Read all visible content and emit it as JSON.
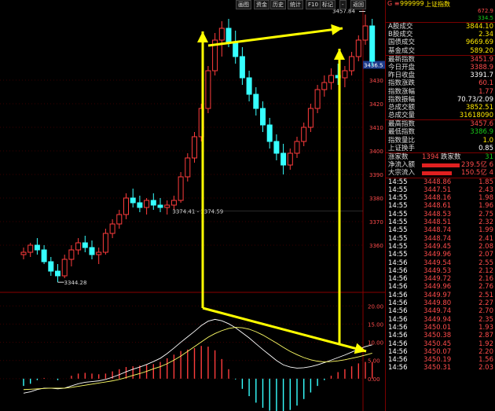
{
  "toolbar": {
    "buttons": [
      "画图",
      "资金",
      "历史",
      "统计",
      "F10",
      "标记",
      "-",
      "返回"
    ]
  },
  "price_axis": {
    "labels": [
      "3430",
      "3420",
      "3410",
      "3400",
      "3390",
      "3380",
      "3370",
      "3360"
    ],
    "current_price_tag": "3436.5"
  },
  "annotations": {
    "high_label": "3457.84",
    "mid_label": "3374.41 - 3374.59",
    "low_label": "3344.28"
  },
  "macd_axis": {
    "labels": [
      "20.00",
      "15.00",
      "10.00",
      "5.00",
      "0.00"
    ]
  },
  "chart_data": {
    "type": "candlestick",
    "price_ylim": [
      3344,
      3460
    ],
    "candles": [
      [
        3356,
        3359,
        3354,
        3357
      ],
      [
        3357,
        3361,
        3355,
        3360
      ],
      [
        3360,
        3363,
        3356,
        3358
      ],
      [
        3358,
        3360,
        3352,
        3353
      ],
      [
        3353,
        3355,
        3347,
        3349
      ],
      [
        3349,
        3352,
        3344.28,
        3347
      ],
      [
        3347,
        3356,
        3346,
        3354
      ],
      [
        3354,
        3360,
        3351,
        3358
      ],
      [
        3358,
        3363,
        3356,
        3361
      ],
      [
        3361,
        3364,
        3357,
        3359
      ],
      [
        3359,
        3362,
        3354,
        3356
      ],
      [
        3356,
        3359,
        3352,
        3357
      ],
      [
        3357,
        3367,
        3356,
        3365
      ],
      [
        3365,
        3371,
        3363,
        3369
      ],
      [
        3369,
        3375,
        3367,
        3373
      ],
      [
        3373,
        3382,
        3371,
        3380
      ],
      [
        3380,
        3384,
        3376,
        3378
      ],
      [
        3378,
        3381,
        3374,
        3376
      ],
      [
        3376,
        3380,
        3373,
        3379
      ],
      [
        3379,
        3382,
        3375,
        3377
      ],
      [
        3377,
        3380,
        3374,
        3376
      ],
      [
        3376,
        3379,
        3373,
        3377
      ],
      [
        3377,
        3381,
        3375,
        3379
      ],
      [
        3379,
        3391,
        3378,
        3389
      ],
      [
        3389,
        3399,
        3387,
        3397
      ],
      [
        3397,
        3408,
        3395,
        3406
      ],
      [
        3406,
        3420,
        3404,
        3418
      ],
      [
        3418,
        3436,
        3416,
        3434
      ],
      [
        3434,
        3450,
        3432,
        3447
      ],
      [
        3447,
        3455,
        3440,
        3452
      ],
      [
        3452,
        3456,
        3444,
        3446
      ],
      [
        3446,
        3451,
        3437,
        3440
      ],
      [
        3440,
        3444,
        3428,
        3431
      ],
      [
        3431,
        3434,
        3421,
        3424
      ],
      [
        3424,
        3427,
        3415,
        3418
      ],
      [
        3418,
        3421,
        3408,
        3411
      ],
      [
        3411,
        3414,
        3401,
        3404
      ],
      [
        3404,
        3407,
        3396,
        3399
      ],
      [
        3399,
        3403,
        3390,
        3394
      ],
      [
        3394,
        3401,
        3392,
        3399
      ],
      [
        3399,
        3406,
        3397,
        3404
      ],
      [
        3404,
        3412,
        3402,
        3410
      ],
      [
        3410,
        3420,
        3408,
        3418
      ],
      [
        3418,
        3428,
        3416,
        3426
      ],
      [
        3426,
        3432,
        3423,
        3429
      ],
      [
        3429,
        3435,
        3426,
        3432
      ],
      [
        3432,
        3437,
        3428,
        3431
      ],
      [
        3431,
        3436,
        3427,
        3434
      ],
      [
        3434,
        3442,
        3432,
        3440
      ],
      [
        3440,
        3449,
        3438,
        3447
      ],
      [
        3447,
        3457.84,
        3445,
        3453
      ],
      [
        3453,
        3456,
        3436,
        3438
      ]
    ],
    "macd_ylim": [
      -5,
      22
    ],
    "dif": [
      -4,
      -3.6,
      -3,
      -2.6,
      -2.6,
      -2.8,
      -2.6,
      -2,
      -1.4,
      -1,
      -0.8,
      -0.6,
      -0.2,
      0.4,
      1.1,
      1.9,
      2.6,
      3.2,
      3.9,
      4.7,
      5.6,
      6.9,
      8.4,
      10,
      11.5,
      13,
      14.6,
      15.8,
      16.3,
      15.9,
      15.1,
      14,
      12.6,
      11.2,
      9.6,
      8,
      6.5,
      5,
      3.8,
      3.2,
      2.9,
      3,
      3.3,
      3.8,
      4.4,
      5.1,
      5.8,
      6.5,
      7.3,
      8.1,
      8.8,
      9.3
    ],
    "dea": [
      -3,
      -2.9,
      -2.8,
      -2.7,
      -2.6,
      -2.6,
      -2.6,
      -2.4,
      -2.1,
      -1.8,
      -1.5,
      -1.2,
      -0.9,
      -0.6,
      -0.2,
      0.3,
      0.9,
      1.4,
      2,
      2.7,
      3.3,
      4.1,
      5.1,
      6.2,
      7.5,
      8.8,
      10.1,
      11.4,
      12.4,
      13.2,
      13.8,
      14.1,
      14,
      13.6,
      12.9,
      12,
      10.9,
      9.8,
      8.6,
      7.5,
      6.6,
      5.8,
      5.2,
      4.8,
      4.6,
      4.7,
      4.9,
      5.2,
      5.6,
      6,
      6.5,
      7
    ]
  },
  "quote": {
    "header": {
      "code_prefix": "G ≡",
      "code": "999999",
      "name": "上证指数",
      "val1": "672.9",
      "val2": "334.5"
    },
    "rows": [
      {
        "label": "A股成交",
        "value": "3844.10"
      },
      {
        "label": "B股成交",
        "value": "2.34"
      },
      {
        "label": "国债成交",
        "value": "9669.69"
      },
      {
        "label": "基金成交",
        "value": "589.20"
      },
      {
        "label": "最新指数",
        "value": "3451.9"
      },
      {
        "label": "今日开盘",
        "value": "3388.9"
      },
      {
        "label": "昨日收盘",
        "value": "3391.7"
      },
      {
        "label": "指数涨跌",
        "value": "60.1"
      },
      {
        "label": "指数涨幅",
        "value": "1.77"
      },
      {
        "label": "指数振幅",
        "value": "70.73/2.09"
      },
      {
        "label": "总成交额",
        "value": "3852.51"
      },
      {
        "label": "总成交量",
        "value": "31618090"
      },
      {
        "label": "最高指数",
        "value": "3457.6"
      },
      {
        "label": "最低指数",
        "value": "3386.9"
      },
      {
        "label": "指数量比",
        "value": "1.0"
      },
      {
        "label": "上证换手",
        "value": "0.85"
      }
    ],
    "breadth": {
      "up_label": "涨家数",
      "up_value": "1394",
      "down_label": "跌家数",
      "down_value": "31"
    },
    "flows": [
      {
        "label": "净流入额",
        "value": "239.5亿",
        "extra": "6"
      },
      {
        "label": "大宗流入",
        "value": "150.5亿",
        "extra": "4"
      }
    ],
    "ticks": [
      [
        "14:55",
        "3448.86",
        "1.85"
      ],
      [
        "14:55",
        "3447.51",
        "2.43"
      ],
      [
        "14:55",
        "3448.16",
        "1.98"
      ],
      [
        "14:55",
        "3448.61",
        "1.96"
      ],
      [
        "14:55",
        "3448.53",
        "2.75"
      ],
      [
        "14:55",
        "3448.51",
        "2.32"
      ],
      [
        "14:55",
        "3448.74",
        "1.99"
      ],
      [
        "14:55",
        "3448.74",
        "2.41"
      ],
      [
        "14:55",
        "3449.45",
        "2.08"
      ],
      [
        "14:55",
        "3449.96",
        "2.07"
      ],
      [
        "14:56",
        "3449.54",
        "2.55"
      ],
      [
        "14:56",
        "3449.53",
        "2.12"
      ],
      [
        "14:56",
        "3449.72",
        "2.16"
      ],
      [
        "14:56",
        "3449.96",
        "2.76"
      ],
      [
        "14:56",
        "3449.97",
        "2.51"
      ],
      [
        "14:56",
        "3449.80",
        "2.27"
      ],
      [
        "14:56",
        "3449.74",
        "2.70"
      ],
      [
        "14:56",
        "3449.94",
        "2.35"
      ],
      [
        "14:56",
        "3450.01",
        "1.93"
      ],
      [
        "14:56",
        "3450.38",
        "2.87"
      ],
      [
        "14:56",
        "3450.45",
        "1.92"
      ],
      [
        "14:56",
        "3450.07",
        "2.20"
      ],
      [
        "14:56",
        "3450.19",
        "1.56"
      ],
      [
        "14:56",
        "3450.31",
        "2.03"
      ]
    ]
  },
  "colors": {
    "up": "#ff3c3c",
    "down": "#36ffff",
    "arrow": "#ffff00",
    "dif": "#ffffff",
    "dea": "#ffff66"
  }
}
